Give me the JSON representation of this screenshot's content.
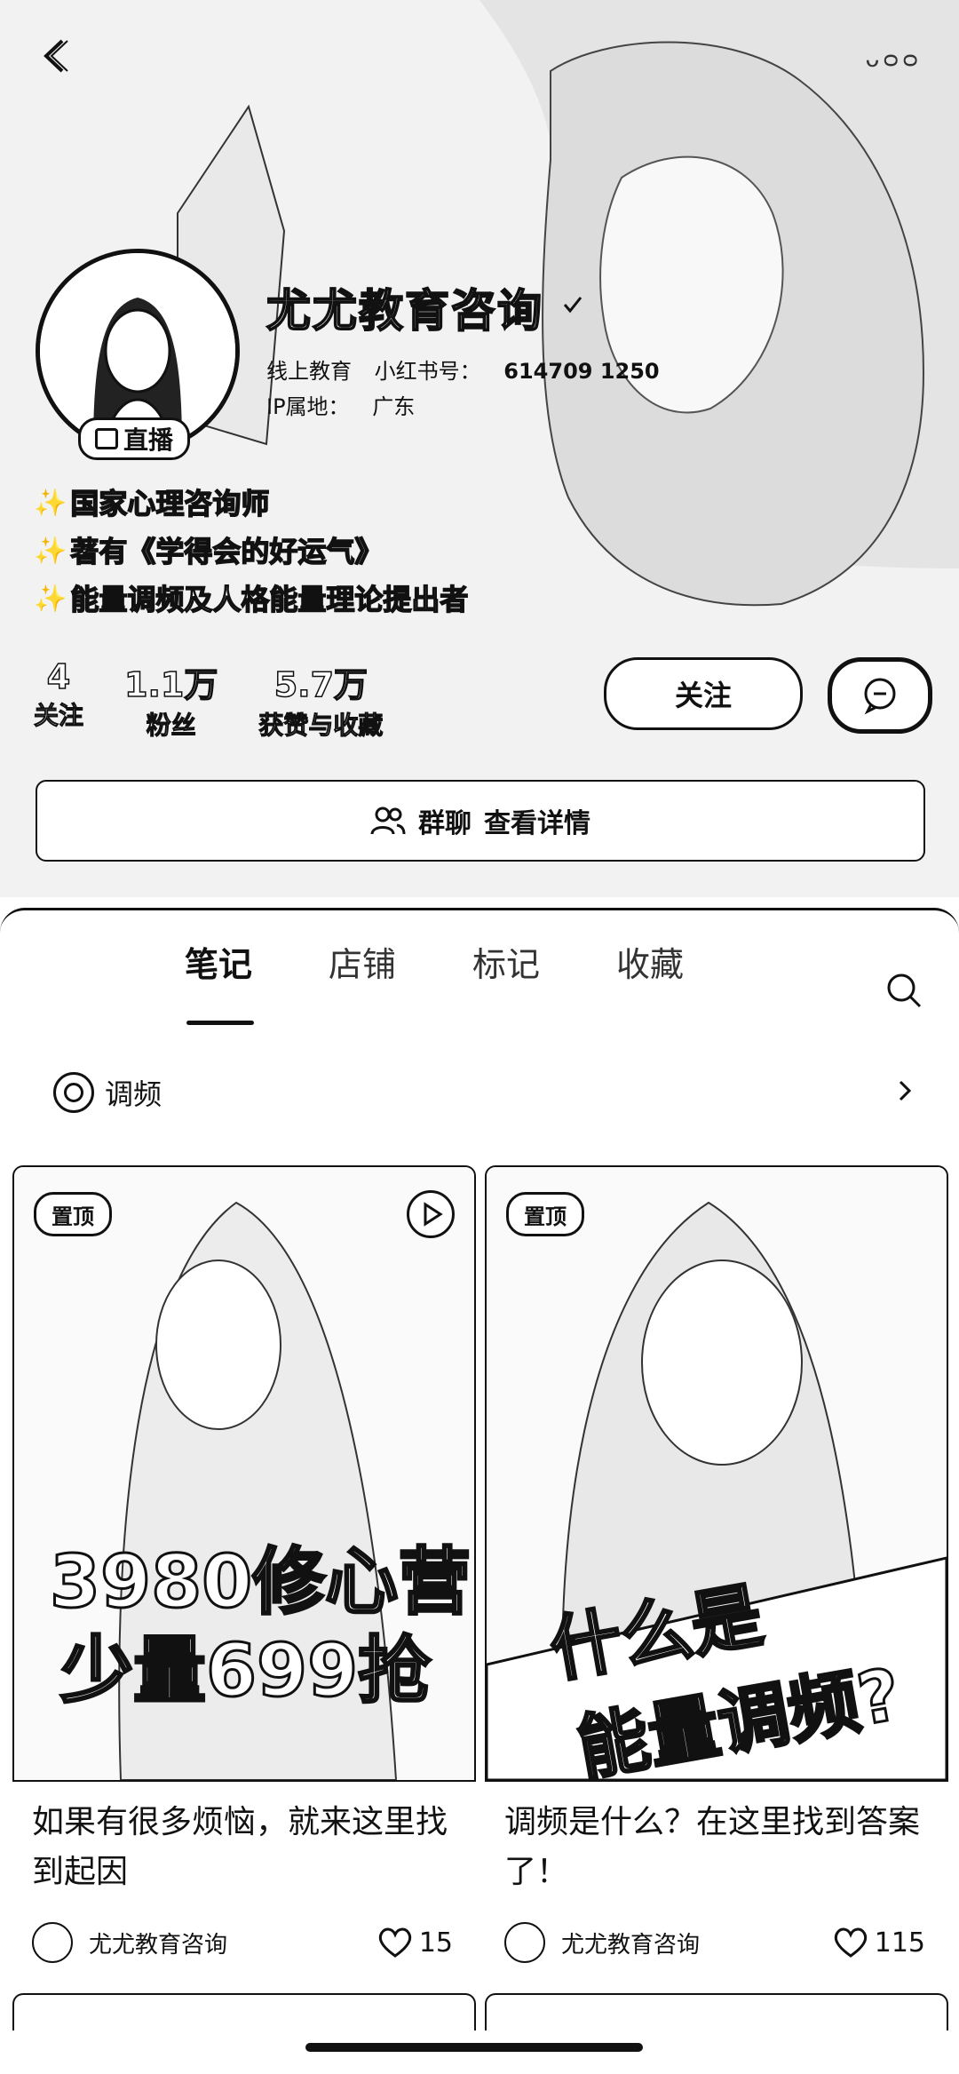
{
  "header": {
    "ornament": "ᴗᴑᴑ",
    "name": "尤尤教育咨询",
    "category": "线上教育",
    "account_label": "小红书号：",
    "account_id": "614709 1250",
    "ip_label": "IP属地：",
    "ip_value": "广东",
    "live_label": "直播",
    "bio": [
      "国家心理咨询师",
      "著有《学得会的好运气》",
      "能量调频及人格能量理论提出者"
    ],
    "stats": [
      {
        "value": "4",
        "label": "关注"
      },
      {
        "value": "1.1万",
        "label": "粉丝"
      },
      {
        "value": "5.7万",
        "label": "获赞与收藏"
      }
    ],
    "follow_label": "关注",
    "group_chat_label": "群聊",
    "group_detail_label": "查看详情"
  },
  "tabs": [
    {
      "label": "笔记",
      "active": true
    },
    {
      "label": "店铺",
      "active": false
    },
    {
      "label": "标记",
      "active": false
    },
    {
      "label": "收藏",
      "active": false
    }
  ],
  "collection": {
    "label": "调频"
  },
  "cards": [
    {
      "pin_label": "置顶",
      "overlay_line1": "3980修心营",
      "overlay_line2": "少量699抢",
      "title": "如果有很多烦恼，就来这里找到起因",
      "author": "尤尤教育咨询",
      "likes": "15",
      "has_video": true
    },
    {
      "pin_label": "置顶",
      "overlay_line1": "什么是",
      "overlay_line2": "能量调频?",
      "title": "调频是什么？在这里找到答案了！",
      "author": "尤尤教育咨询",
      "likes": "115",
      "has_video": false
    }
  ],
  "icons": [
    "back-icon",
    "verified-icon",
    "tv-icon",
    "sparkle-icon",
    "chat-icon",
    "group-icon",
    "search-icon",
    "collection-icon",
    "chevron-right-icon",
    "play-icon",
    "heart-icon"
  ]
}
